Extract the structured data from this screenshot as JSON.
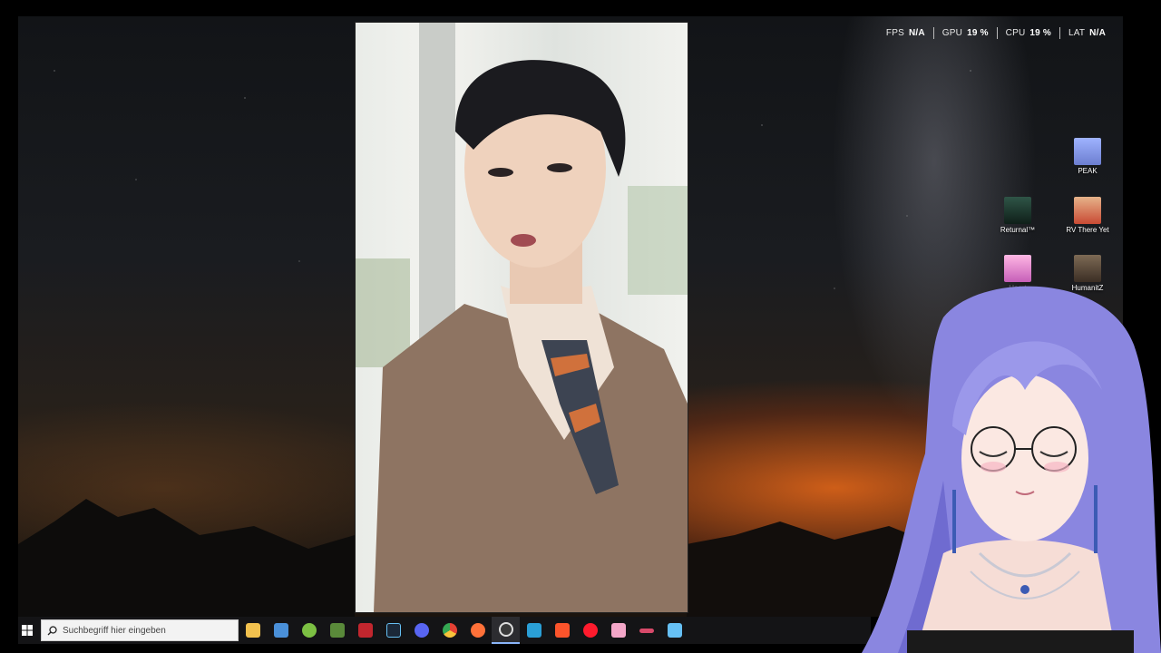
{
  "performance_overlay": {
    "fps_label": "FPS",
    "fps_value": "N/A",
    "gpu_label": "GPU",
    "gpu_value": "19 %",
    "cpu_label": "CPU",
    "cpu_value": "19 %",
    "lat_label": "LAT",
    "lat_value": "N/A"
  },
  "desktop_icons": [
    {
      "label": "PEAK",
      "icon": "peak-game-icon",
      "color": "#7f8fd6"
    },
    {
      "label": "Returnal™",
      "icon": "returnal-game-icon",
      "color": "#1f3a2e"
    },
    {
      "label": "RV There Yet",
      "icon": "rv-there-yet-game-icon",
      "color": "#c94a34"
    },
    {
      "label": "Heart",
      "icon": "anime-game-icon",
      "color": "#e77ac0"
    },
    {
      "label": "HumanitZ",
      "icon": "humanitz-game-icon",
      "color": "#5b4a3a"
    }
  ],
  "taskbar": {
    "search_placeholder": "Suchbegriff hier eingeben",
    "apps": [
      {
        "name": "file-explorer-icon",
        "color": "#f2c14e"
      },
      {
        "name": "calculator-icon",
        "color": "#4a90d9"
      },
      {
        "name": "android-app-icon",
        "color": "#7cc043"
      },
      {
        "name": "minecraft-icon",
        "color": "#5a8a3a"
      },
      {
        "name": "media-app-icon",
        "color": "#c2262e"
      },
      {
        "name": "steam-icon",
        "color": "#1b2838"
      },
      {
        "name": "discord-icon",
        "color": "#5865f2"
      },
      {
        "name": "chrome-icon",
        "color": "#e44133"
      },
      {
        "name": "firefox-icon",
        "color": "#ff7139"
      },
      {
        "name": "obs-icon",
        "color": "#3a3a3a"
      },
      {
        "name": "app-blue-icon",
        "color": "#2a9fd6"
      },
      {
        "name": "brave-icon",
        "color": "#fb542b"
      },
      {
        "name": "opera-icon",
        "color": "#ff1b2d"
      },
      {
        "name": "pink-app-icon",
        "color": "#f3a6c8"
      },
      {
        "name": "tool-icon",
        "color": "#d84a6a"
      },
      {
        "name": "steam-alt-icon",
        "color": "#66c0f4"
      }
    ]
  }
}
